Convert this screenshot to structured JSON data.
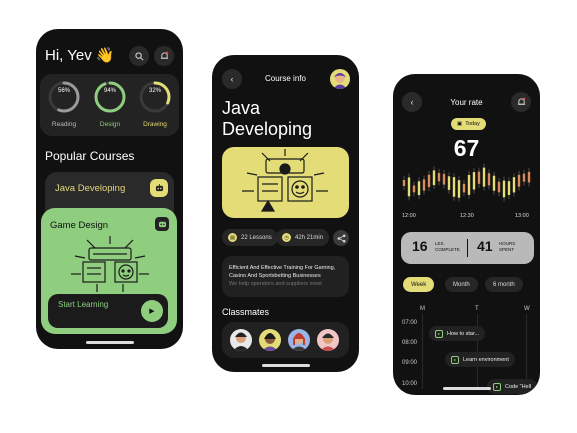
{
  "colors": {
    "yellow": "#e4dc76",
    "green": "#8fce7f",
    "bg": "#111111"
  },
  "home": {
    "greeting": "Hi, Yev 👋",
    "stats": [
      {
        "label": "Reading",
        "value": "56%",
        "progress": 0.56,
        "color": "#9a9a9a"
      },
      {
        "label": "Design",
        "value": "94%",
        "progress": 0.94,
        "color": "#8fce7f"
      },
      {
        "label": "Drawing",
        "value": "32%",
        "progress": 0.32,
        "color": "#e4dc76"
      }
    ],
    "section_title": "Popular Courses",
    "courses": [
      {
        "title": "Java Developing"
      },
      {
        "title": "Game Design",
        "cta": "Start Learning"
      }
    ],
    "icons": {
      "search": "search-icon",
      "bell": "bell-icon"
    }
  },
  "course": {
    "header": "Course info",
    "title_line1": "Java",
    "title_line2": "Developing",
    "lessons": "22 Lessons",
    "duration": "42h 21min",
    "description": "Efficient And Effective Training For Gaming, Casino And Sportsbetting Businesses",
    "description_more": "We help operators and suppliers meet",
    "classmates_title": "Classmates"
  },
  "rate": {
    "header": "Your rate",
    "today": "Today",
    "value": "67",
    "chart_times": [
      "12:00",
      "12:30",
      "13:00"
    ],
    "lessons_complete": {
      "num": "16",
      "label": "LES. COMPLETE"
    },
    "hours_spent": {
      "num": "41",
      "label": "HOURS SPENT"
    },
    "tabs": [
      "Week",
      "Month",
      "6 month"
    ],
    "days": [
      "M",
      "T",
      "W"
    ],
    "times": [
      "07:00",
      "08:00",
      "09:00",
      "10:00"
    ],
    "events": [
      "How to star...",
      "Learn environment",
      "Code \"Hell"
    ]
  }
}
